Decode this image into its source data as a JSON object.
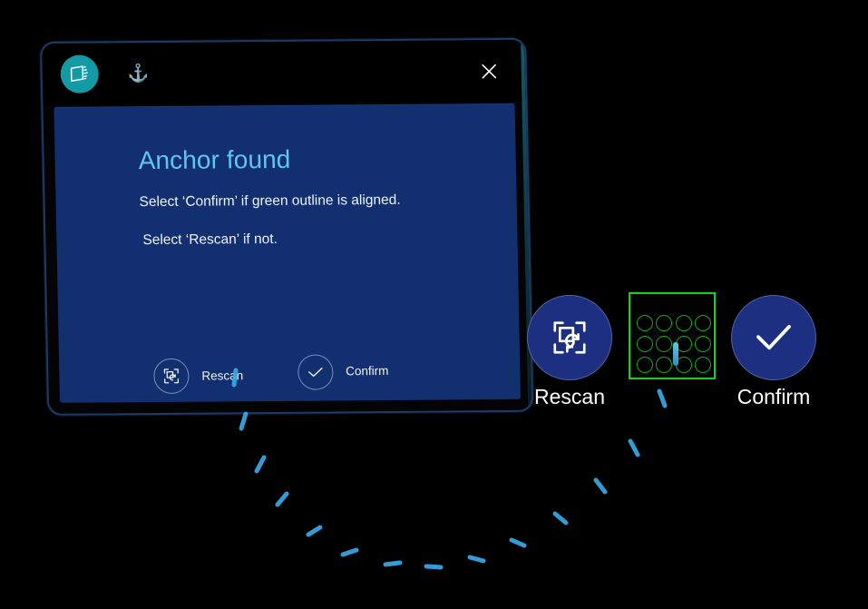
{
  "app": {
    "icon": "hologram-slate-icon",
    "anchor_icon": "anchor-icon",
    "anchor_glyph": "⚓",
    "close_icon": "close-icon"
  },
  "dialog": {
    "title": "Anchor found",
    "line1": "Select ‘Confirm’ if green outline is aligned.",
    "line2": "Select ‘Rescan’ if not.",
    "inline_actions": [
      {
        "label": "Rescan",
        "icon": "rescan-icon"
      },
      {
        "label": "Confirm",
        "icon": "check-icon"
      }
    ]
  },
  "floating_buttons": [
    {
      "label": "Rescan",
      "icon": "rescan-icon"
    },
    {
      "label": "Confirm",
      "icon": "check-icon"
    }
  ],
  "anchor_marker": {
    "name": "green-anchor-outline",
    "grid_columns": 4,
    "grid_rows": 3,
    "outline_color": "#17d317",
    "dot_color": "#1aa81a",
    "pin_color": "#63c7e8"
  },
  "colors": {
    "background": "#000000",
    "panel_blue": "#123070",
    "panel_frame": "#1d3a63",
    "title_blue": "#5fc6f0",
    "app_badge_teal": "#149aa6",
    "button_blue": "#1c2f80",
    "arc_cyan": "#39a9e8",
    "text_white": "#f0f3f8"
  },
  "arc": {
    "name": "dashed-placement-arc",
    "dash_count": 14,
    "color": "#39a9e8"
  }
}
